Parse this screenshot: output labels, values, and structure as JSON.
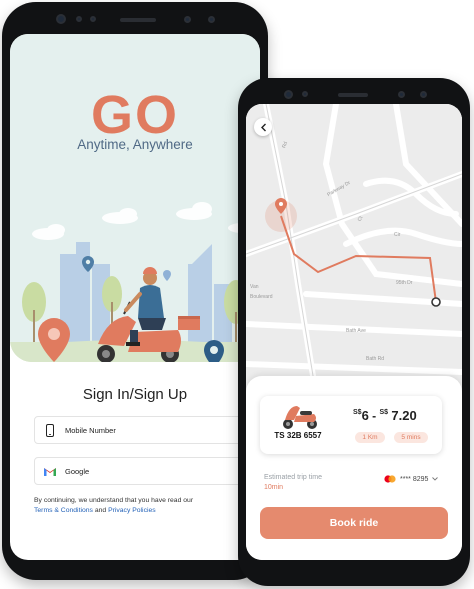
{
  "left_screen": {
    "logo": "GO",
    "tagline": "Anytime, Anywhere",
    "signin_title": "Sign In/Sign Up",
    "mobile_label": "Mobile Number",
    "google_label": "Google",
    "consent_text": "By continuing, we understand that you have read our",
    "terms_link": "Terms & Conditions",
    "and_text": "and",
    "privacy_link": "Privacy Policies"
  },
  "right_screen": {
    "map_streets": [
      "Boulevard",
      "Parkway Dr",
      "Rd",
      "Ct",
      "Cir",
      "95th Dr",
      "Bath Ave",
      "Bath Rd",
      "Van"
    ],
    "vehicle_plate": "TS 32B 6557",
    "price_currency_1": "S$",
    "price_low": "6",
    "price_sep": "-",
    "price_currency_2": "S$",
    "price_high": "7.20",
    "distance": "1 Km",
    "duration": "5 mins",
    "est_label": "Estimated trip time",
    "est_value": "10min",
    "card_number": "**** 8295",
    "book_button": "Book ride"
  },
  "colors": {
    "accent": "#e07b5f",
    "button": "#e58a6e",
    "hero_bg": "#e4f0ee",
    "tagline": "#506a86",
    "link": "#2563b8"
  },
  "icons": [
    "phone-icon",
    "google-icon",
    "back-chevron-icon",
    "scooter-icon",
    "mastercard-icon",
    "chevron-down-icon",
    "location-pin-icon"
  ]
}
